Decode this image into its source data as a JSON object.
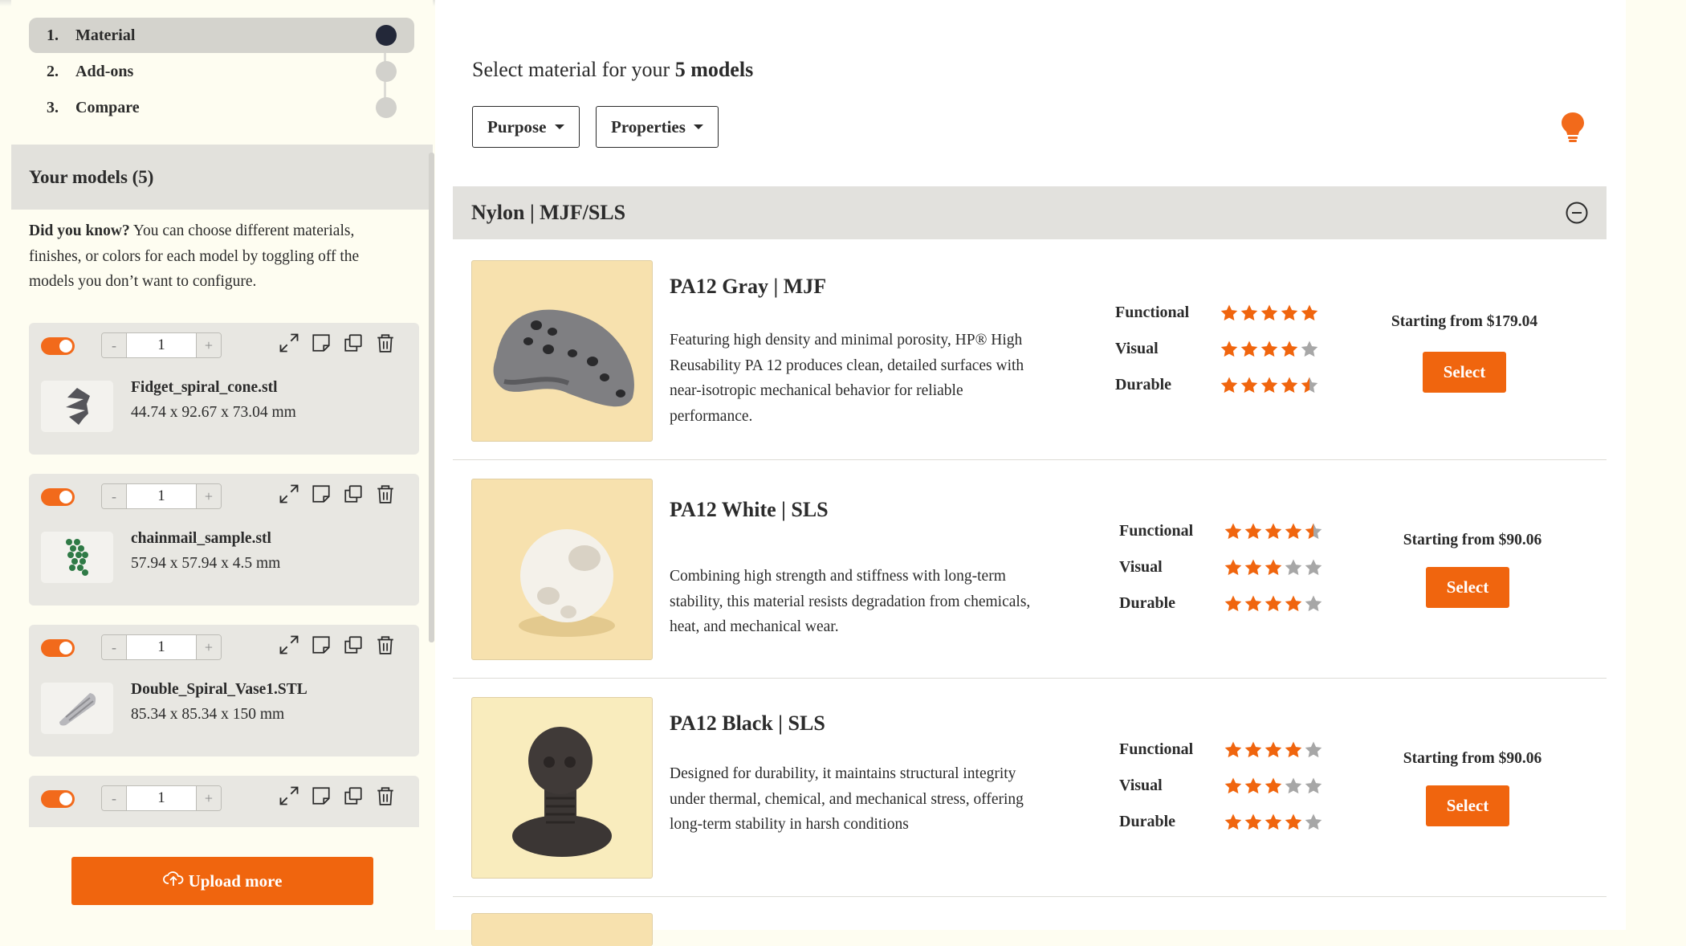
{
  "steps": [
    {
      "num": "1.",
      "label": "Material"
    },
    {
      "num": "2.",
      "label": "Add-ons"
    },
    {
      "num": "3.",
      "label": "Compare"
    }
  ],
  "sidebar": {
    "models_title": "Your models (5)",
    "tip_bold": "Did you know?",
    "tip_text": " You can choose different materials, finishes, or colors for each model by toggling off the models you don’t want to configure.",
    "upload_label": "Upload more"
  },
  "models": [
    {
      "qty": "1",
      "name": "Fidget_spiral_cone.stl",
      "dims": "44.74 x 92.67 x 73.04 mm"
    },
    {
      "qty": "1",
      "name": "chainmail_sample.stl",
      "dims": "57.94 x 57.94 x 4.5 mm"
    },
    {
      "qty": "1",
      "name": "Double_Spiral_Vase1.STL",
      "dims": "85.34 x 85.34 x 150 mm"
    },
    {
      "qty": "1",
      "name": "",
      "dims": ""
    }
  ],
  "main": {
    "heading_prefix": "Select material for your ",
    "heading_bold": "5 models",
    "filters": [
      "Purpose",
      "Properties"
    ],
    "group_title": "Nylon | MJF/SLS"
  },
  "rating_labels": {
    "functional": "Functional",
    "visual": "Visual",
    "durable": "Durable"
  },
  "materials": [
    {
      "title": "PA12 Gray | MJF",
      "description": "Featuring high density and minimal porosity, HP® High Reusability PA 12 produces clean, detailed surfaces with near-isotropic mechanical behavior for reliable performance.",
      "ratings": {
        "functional": 5,
        "visual": 4,
        "durable": 4.5
      },
      "price": "Starting from $179.04",
      "button": "Select"
    },
    {
      "title": "PA12 White | SLS",
      "description": "Combining high strength and stiffness with long-term stability, this material resists degradation from chemicals, heat, and mechanical wear.",
      "ratings": {
        "functional": 4.5,
        "visual": 3,
        "durable": 4
      },
      "price": "Starting from $90.06",
      "button": "Select"
    },
    {
      "title": "PA12 Black | SLS",
      "description": "Designed for durability, it maintains structural integrity under thermal, chemical, and mechanical stress, offering long-term stability in harsh conditions",
      "ratings": {
        "functional": 4,
        "visual": 3,
        "durable": 4
      },
      "price": "Starting from $90.06",
      "button": "Select"
    }
  ],
  "colors": {
    "accent": "#f0650e",
    "star_empty": "#a7a7a7",
    "step_active": "#232839"
  },
  "icons": [
    "expand-icon",
    "note-icon",
    "duplicate-icon",
    "trash-icon",
    "upload-cloud-icon",
    "lightbulb-icon",
    "collapse-minus-icon",
    "star-icon"
  ]
}
